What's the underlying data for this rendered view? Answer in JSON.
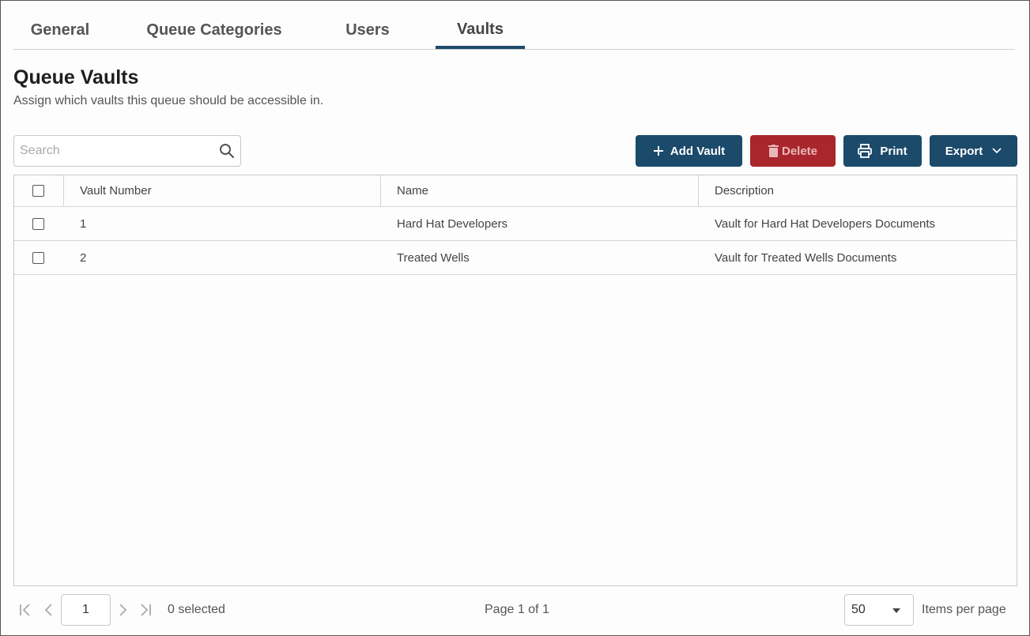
{
  "tabs": [
    {
      "label": "General"
    },
    {
      "label": "Queue Categories"
    },
    {
      "label": "Users"
    },
    {
      "label": "Vaults",
      "active": true
    }
  ],
  "page": {
    "title": "Queue Vaults",
    "subtitle": "Assign which vaults this queue should be accessible in."
  },
  "search": {
    "placeholder": "Search",
    "value": ""
  },
  "toolbar": {
    "add_label": "Add Vault",
    "delete_label": "Delete",
    "print_label": "Print",
    "export_label": "Export"
  },
  "table": {
    "columns": [
      "Vault Number",
      "Name",
      "Description"
    ],
    "rows": [
      {
        "number": "1",
        "name": "Hard Hat Developers",
        "description": "Vault for Hard Hat Developers Documents"
      },
      {
        "number": "2",
        "name": "Treated Wells",
        "description": "Vault for Treated Wells Documents"
      }
    ]
  },
  "pager": {
    "current_page": "1",
    "selected_text": "0 selected",
    "page_info": "Page 1 of 1",
    "items_per_page": "50",
    "items_per_page_label": "Items per page"
  },
  "colors": {
    "primary": "#1b4a6b",
    "danger": "#a8262c",
    "border": "#c8c8c8"
  },
  "icons": [
    "search-icon",
    "plus-icon",
    "trash-icon",
    "printer-icon",
    "chevron-down-icon",
    "first-page-icon",
    "prev-page-icon",
    "next-page-icon",
    "last-page-icon"
  ]
}
